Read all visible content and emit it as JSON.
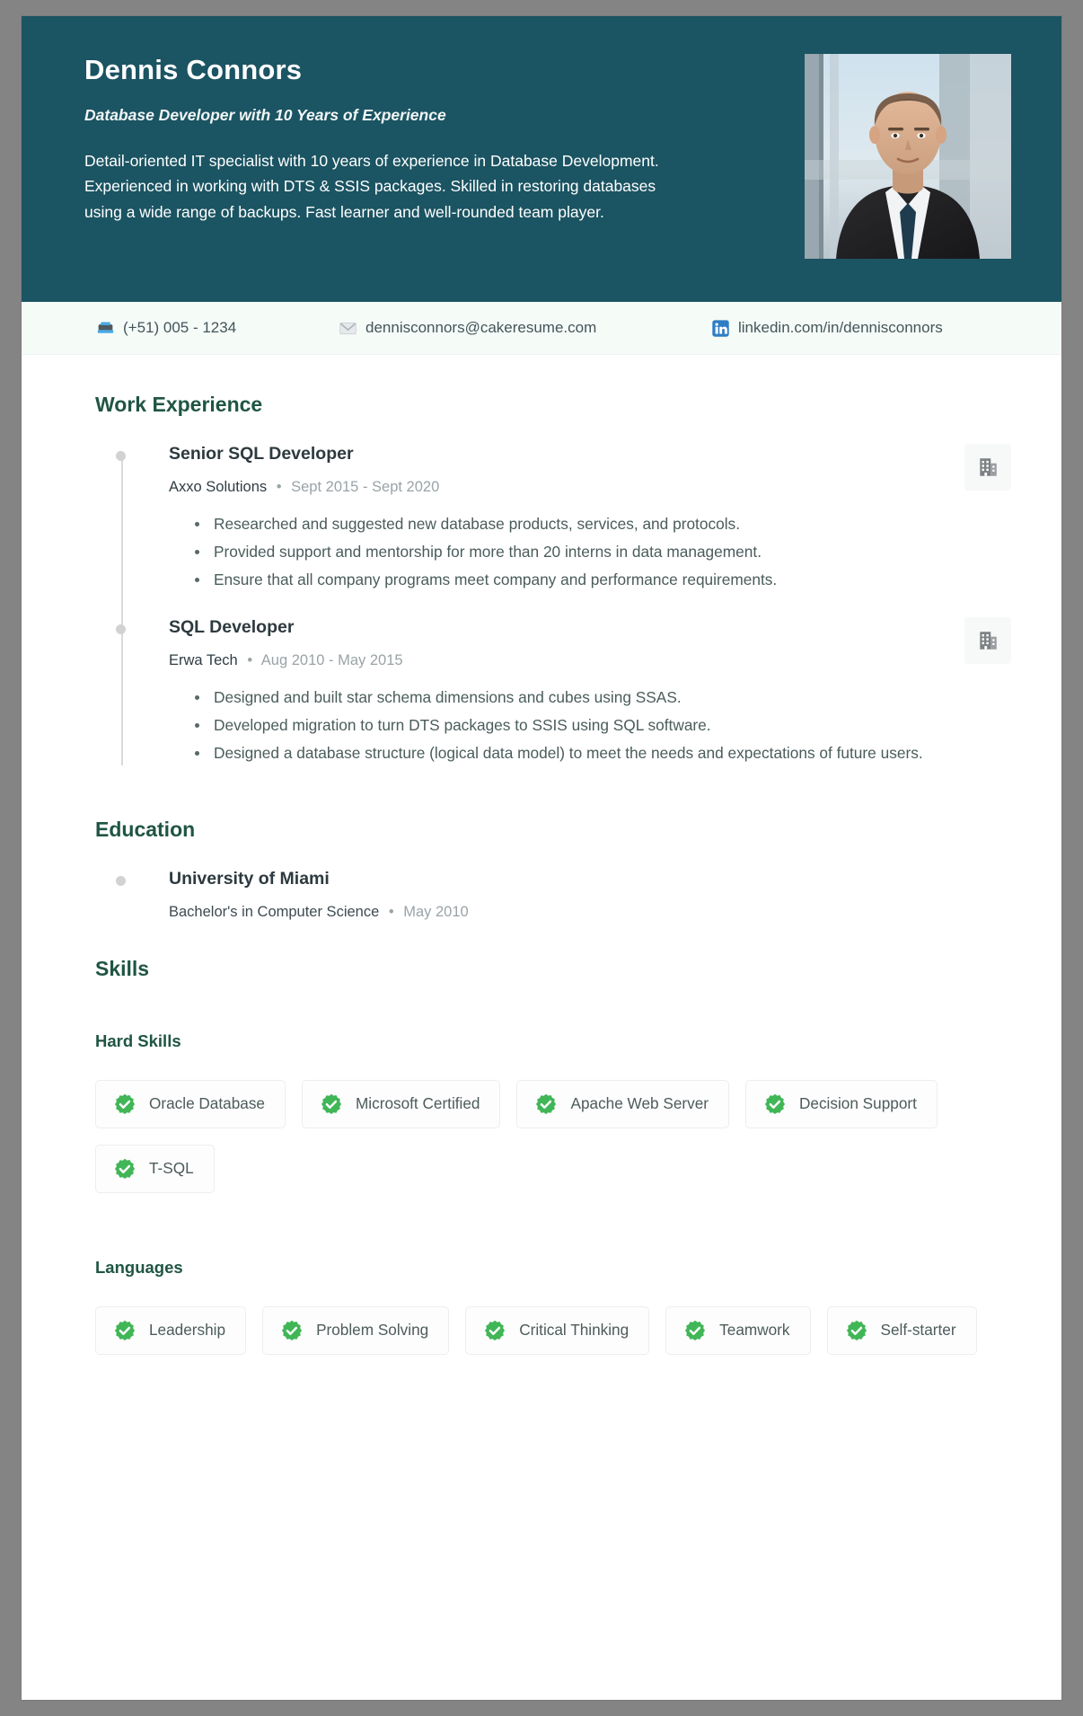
{
  "theme": {
    "page_background": "#848484",
    "header_background": "#1b5462",
    "contact_bar_background": "#f5fbf7",
    "section_title_color": "#1f5544",
    "badge_green": "#41b657",
    "linkedin_blue": "#2f7ec4"
  },
  "header": {
    "name": "Dennis Connors",
    "headline": "Database Developer with 10 Years of Experience",
    "summary": "Detail-oriented IT specialist with 10 years of experience in Database Development. Experienced in working with DTS & SSIS packages. Skilled in restoring databases using a wide range of backups. Fast learner and well-rounded team player.",
    "photo_alt": "portrait-photo"
  },
  "contact": [
    {
      "icon": "phone-icon",
      "value": "(+51) 005 - 1234"
    },
    {
      "icon": "email-icon",
      "value": "dennisconnors@cakeresume.com"
    },
    {
      "icon": "linkedin-icon",
      "value": "linkedin.com/in/dennisconnors"
    }
  ],
  "work_experience": {
    "title": "Work Experience",
    "entries": [
      {
        "job_title": "Senior SQL Developer",
        "company": "Axxo Solutions",
        "separator": "•",
        "dates": "Sept 2015 - Sept 2020",
        "icon": "building-icon",
        "bullets": [
          "Researched and suggested new database products, services, and protocols.",
          "Provided support and mentorship for more than 20 interns in data management.",
          "Ensure that all company programs meet company and performance requirements."
        ]
      },
      {
        "job_title": "SQL Developer",
        "company": "Erwa Tech",
        "separator": "•",
        "dates": "Aug 2010 - May 2015",
        "icon": "building-icon",
        "bullets": [
          "Designed and built star schema dimensions and cubes using SSAS.",
          "Developed migration to turn DTS packages to SSIS using SQL software.",
          "Designed a database structure (logical data model) to meet the needs and expectations of future users."
        ]
      }
    ]
  },
  "education": {
    "title": "Education",
    "entries": [
      {
        "school": "University of Miami",
        "degree": "Bachelor's in Computer Science",
        "separator": "•",
        "dates": "May 2010"
      }
    ]
  },
  "skills": {
    "title": "Skills",
    "groups": [
      {
        "label": "Hard Skills",
        "items": [
          "Oracle Database",
          "Microsoft Certified",
          "Apache Web Server",
          "Decision Support",
          "T-SQL"
        ]
      },
      {
        "label": "Languages",
        "items": [
          "Leadership",
          "Problem Solving",
          "Critical Thinking",
          "Teamwork",
          "Self-starter"
        ]
      }
    ]
  }
}
